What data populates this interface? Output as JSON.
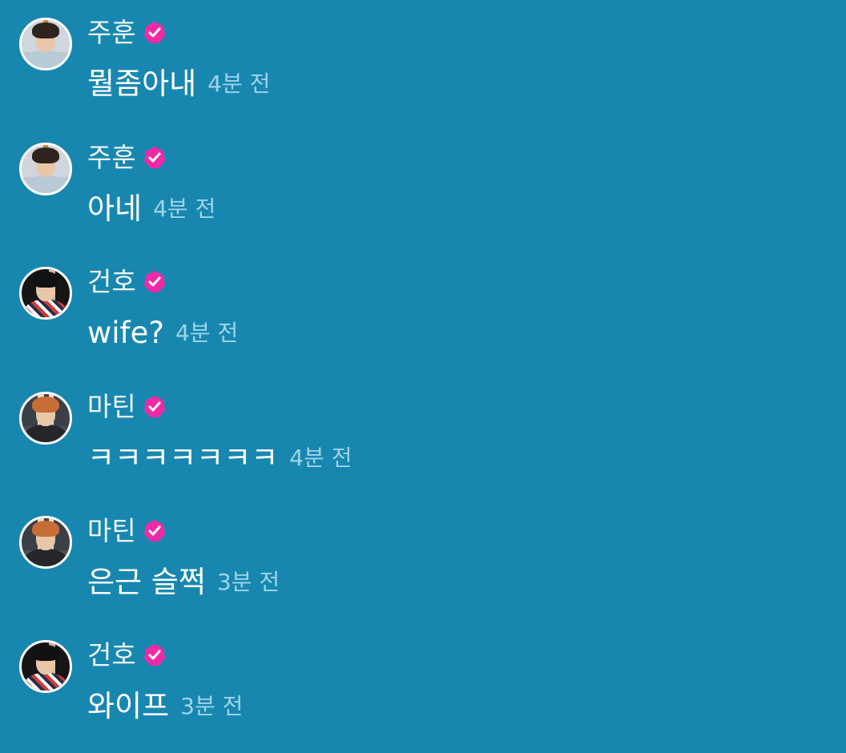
{
  "chat": {
    "messages": [
      {
        "author": "주훈",
        "text": "뭘좀아내",
        "time": "4분 전",
        "verified_icon": "verified-badge-icon",
        "avatar": "avatar-joohoon"
      },
      {
        "author": "주훈",
        "text": "아네",
        "time": "4분 전",
        "verified_icon": "verified-badge-icon",
        "avatar": "avatar-joohoon"
      },
      {
        "author": "건호",
        "text": "wife?",
        "time": "4분 전",
        "verified_icon": "verified-badge-icon",
        "avatar": "avatar-gunho"
      },
      {
        "author": "마틴",
        "text": "ㅋㅋㅋㅋㅋㅋㅋ",
        "time": "4분 전",
        "verified_icon": "verified-badge-icon",
        "avatar": "avatar-martin"
      },
      {
        "author": "마틴",
        "text": "은근 슬쩍",
        "time": "3분 전",
        "verified_icon": "verified-badge-icon",
        "avatar": "avatar-martin"
      },
      {
        "author": "건호",
        "text": "와이프",
        "time": "3분 전",
        "verified_icon": "verified-badge-icon",
        "avatar": "avatar-gunho"
      }
    ]
  },
  "colors": {
    "background": "#1887b0",
    "text": "#ffffff",
    "timestamp": "#9ed4e8",
    "verified_badge": "#f02aa6"
  }
}
